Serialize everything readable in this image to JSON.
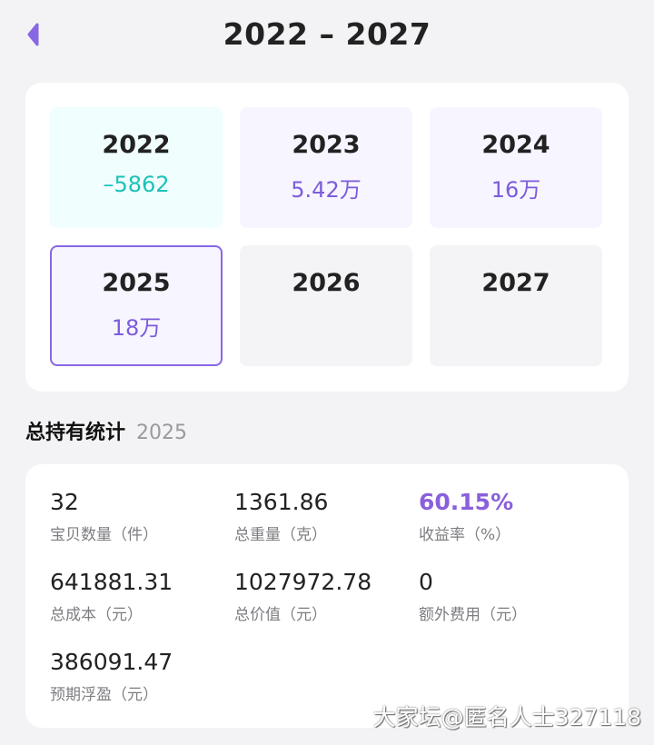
{
  "header": {
    "title": "2022 – 2027",
    "back_icon": "chevron-left-icon",
    "accent_color": "#8867e4"
  },
  "years": [
    {
      "year": "2022",
      "value": "–5862",
      "state": "loss"
    },
    {
      "year": "2023",
      "value": "5.42万",
      "state": "gain"
    },
    {
      "year": "2024",
      "value": "16万",
      "state": "gain"
    },
    {
      "year": "2025",
      "value": "18万",
      "state": "selected"
    },
    {
      "year": "2026",
      "value": "",
      "state": "empty"
    },
    {
      "year": "2027",
      "value": "",
      "state": "empty"
    }
  ],
  "section": {
    "title": "总持有统计",
    "year": "2025"
  },
  "stats": [
    {
      "value": "32",
      "label": "宝贝数量（件）"
    },
    {
      "value": "1361.86",
      "label": "总重量（克）"
    },
    {
      "value": "60.15%",
      "label": "收益率（%）",
      "accent": true
    },
    {
      "value": "641881.31",
      "label": "总成本（元）"
    },
    {
      "value": "1027972.78",
      "label": "总价值（元）"
    },
    {
      "value": "0",
      "label": "额外费用（元）"
    },
    {
      "value": "386091.47",
      "label": "预期浮盈（元）"
    }
  ],
  "colors": {
    "loss": "#1cc2b8",
    "gain": "#7c5cdb",
    "rate": "#8a5fdc"
  },
  "watermark": "大家坛@匿名人士327118"
}
